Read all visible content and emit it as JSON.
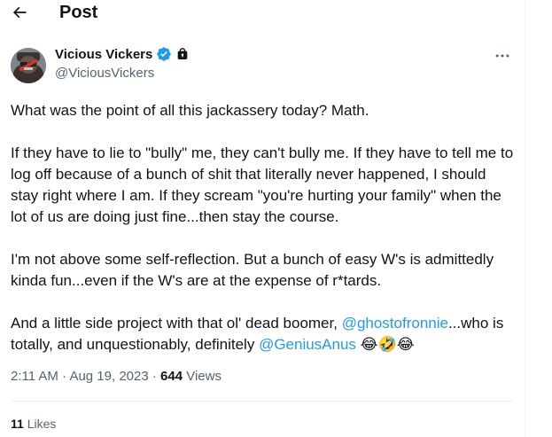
{
  "header": {
    "back_icon": "arrow-left-icon",
    "title": "Post"
  },
  "author": {
    "name": "Vicious Vickers",
    "handle": "@ViciousVickers",
    "verified_icon": "verified-badge-icon",
    "verified_color": "#1d9bf0",
    "protected_icon": "lock-icon"
  },
  "more_icon": "more-horizontal-icon",
  "tweet": {
    "p1": "What was the point of all this jackassery today? Math.",
    "p2": "If they have to lie to \"bully\" me, they can't bully me. If they have to tell me to log off because of a bunch of shit that literally never happened, I should stay right where I am. If they scream \"you're hurting your family\" when the lot of us are doing just fine...then stay the course.",
    "p3": "I'm not above some self-reflection. But a bunch of easy W's is admittedly kinda fun...even if the W's are at the expense of r*tards.",
    "p4_a": "And a little side project with that ol' dead boomer, ",
    "mention1": "@ghostofronnie",
    "p4_b": "...who is totally, and unquestionably, definitely ",
    "mention2": "@GeniusAnus",
    "emojis": "😂🤣😂"
  },
  "meta": {
    "time": "2:11 AM",
    "sep1": " · ",
    "date": "Aug 19, 2023",
    "sep2": " · ",
    "views_count": "644",
    "views_label": " Views"
  },
  "stats": {
    "likes_count": "11",
    "likes_label": " Likes"
  },
  "colors": {
    "accent": "#1d9bf0",
    "secondary_text": "#536471",
    "primary_text": "#0f1419"
  }
}
